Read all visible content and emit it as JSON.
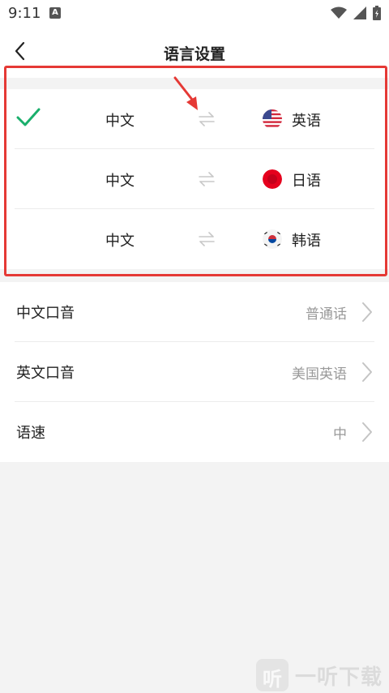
{
  "status_bar": {
    "time": "9:11",
    "notification_badge": "A"
  },
  "nav": {
    "title": "语言设置",
    "back_icon": "chevron-left-icon"
  },
  "language_pairs": [
    {
      "source": "中文",
      "target": "英语",
      "flag": "us-flag-icon",
      "selected": true
    },
    {
      "source": "中文",
      "target": "日语",
      "flag": "japan-flag-icon",
      "selected": false
    },
    {
      "source": "中文",
      "target": "韩语",
      "flag": "korea-flag-icon",
      "selected": false
    }
  ],
  "settings": [
    {
      "label": "中文口音",
      "value": "普通话"
    },
    {
      "label": "英文口音",
      "value": "美国英语"
    },
    {
      "label": "语速",
      "value": "中"
    }
  ],
  "watermark": {
    "logo_char": "听",
    "text": "一听下载"
  },
  "colors": {
    "accent_green": "#1aaf6c",
    "highlight_red": "#e53935",
    "muted_text": "#999999",
    "background": "#f3f3f3"
  }
}
